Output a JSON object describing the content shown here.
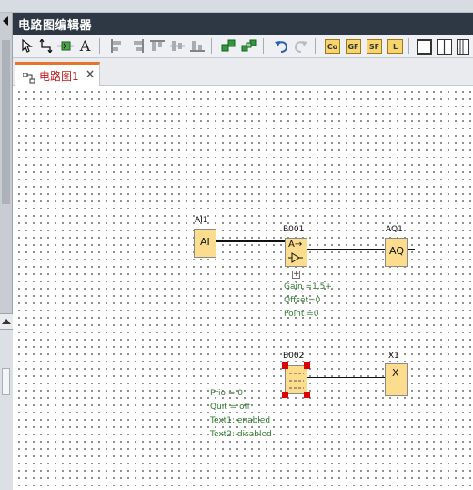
{
  "window": {
    "title": "电路图编辑器"
  },
  "toolbar": {
    "tools": [
      {
        "name": "select-tool",
        "icon": "pointer-arrow-icon"
      },
      {
        "name": "connect-tool",
        "icon": "connector-icon"
      },
      {
        "name": "block-tool",
        "icon": "block-insert-icon"
      },
      {
        "name": "text-tool",
        "label": "A",
        "icon": "text-icon"
      },
      {
        "name": "align-left",
        "icon": "align-left-icon"
      },
      {
        "name": "align-center",
        "icon": "align-center-icon"
      },
      {
        "name": "align-top",
        "icon": "align-top-icon"
      },
      {
        "name": "align-middle",
        "icon": "align-middle-icon"
      },
      {
        "name": "align-bottom",
        "icon": "align-bottom-icon"
      },
      {
        "name": "group",
        "icon": "group-icon"
      },
      {
        "name": "ungroup",
        "icon": "ungroup-icon"
      },
      {
        "name": "undo",
        "icon": "undo-icon"
      },
      {
        "name": "redo",
        "icon": "redo-icon"
      }
    ],
    "letter_buttons": [
      "Co",
      "GF",
      "SF",
      "L"
    ],
    "view_buttons": [
      "single-view-icon",
      "split-vertical-icon",
      "split-horizontal-icon"
    ]
  },
  "tabs": [
    {
      "label": "电路图1",
      "close": "×",
      "active": true
    }
  ],
  "colors": {
    "titlebar": "#2e3744",
    "tab_accent": "#e8732c",
    "tab_label": "#c21a1a",
    "block_fill": "#fbdd8d",
    "param_text": "#2e7a2e",
    "selection_handle": "#e00000"
  },
  "diagram": {
    "blocks": [
      {
        "id": "AI1",
        "label": "AI1",
        "body": "AI"
      },
      {
        "id": "B001",
        "label": "B001",
        "body": "A→"
      },
      {
        "id": "AQ1",
        "label": "AQ1",
        "body": "AQ"
      },
      {
        "id": "B002",
        "label": "B002",
        "body": ""
      },
      {
        "id": "X1",
        "label": "X1",
        "body": "X"
      }
    ],
    "expand_button": "+",
    "b001_params": [
      "Gain =1.5+",
      "Offset=0",
      "Point =0"
    ],
    "b002_params": [
      "Prio = 0",
      "Quit = off",
      "Text1: enabled",
      "Text2: disabled"
    ]
  }
}
